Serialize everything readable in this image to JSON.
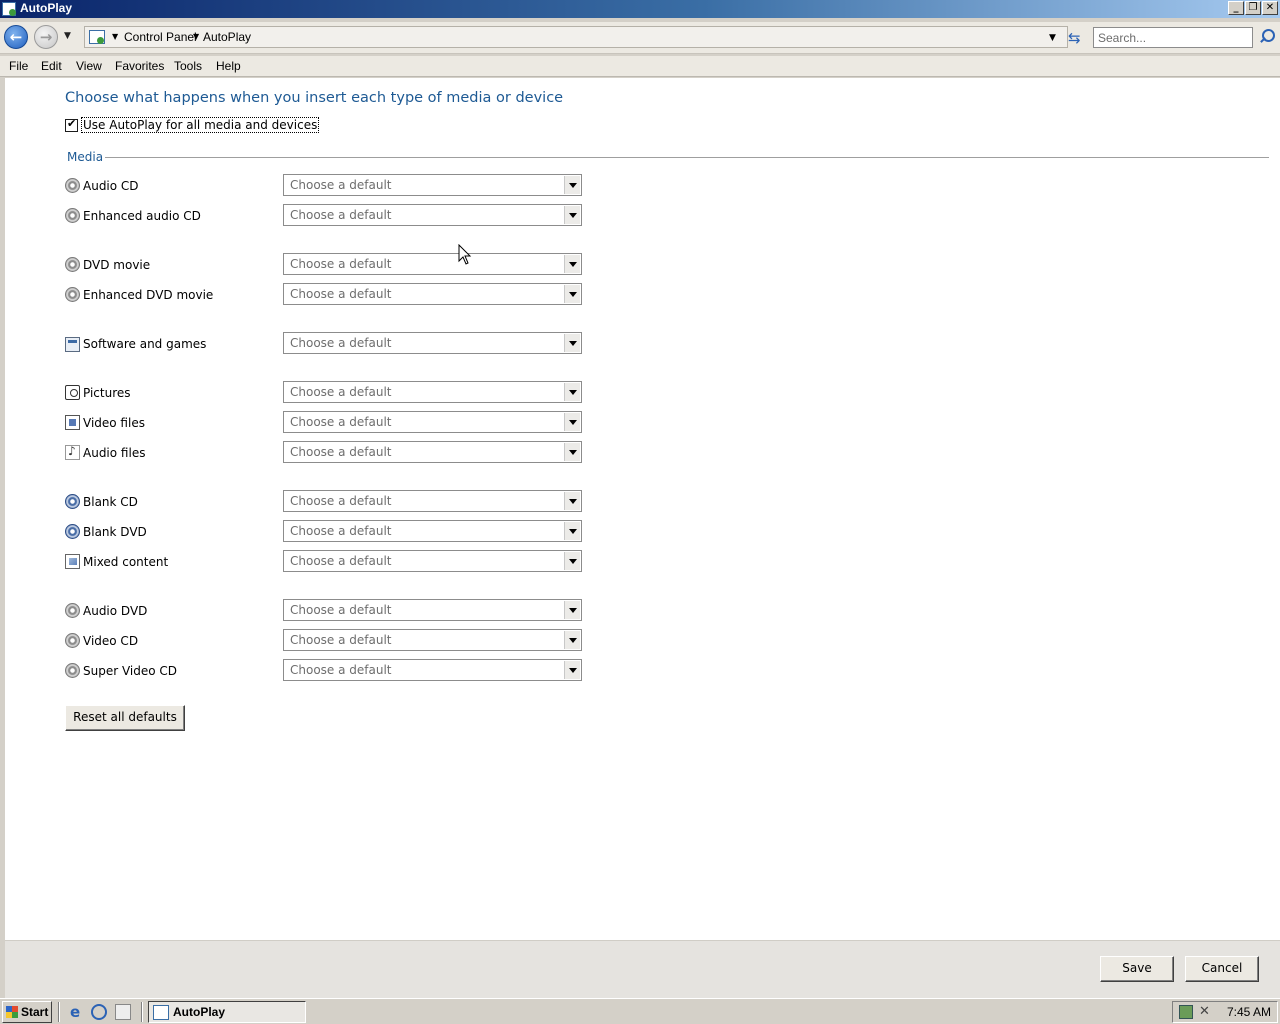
{
  "window": {
    "title": "AutoPlay"
  },
  "address": {
    "crumbs": [
      "Control Panel",
      "AutoPlay"
    ],
    "search_placeholder": "Search..."
  },
  "menu": [
    "File",
    "Edit",
    "View",
    "Favorites",
    "Tools",
    "Help"
  ],
  "content": {
    "heading": "Choose what happens when you insert each type of media or device",
    "use_autoplay_label": "Use AutoPlay for all media and devices",
    "use_autoplay_checked": true,
    "section_label": "Media",
    "select_placeholder": "Choose a default",
    "rows": [
      {
        "label": "Audio CD",
        "icon": "disc-icon",
        "value": "Choose a default"
      },
      {
        "label": "Enhanced audio CD",
        "icon": "disc-icon",
        "value": "Choose a default"
      },
      {
        "label": "DVD movie",
        "icon": "disc-icon",
        "value": "Choose a default"
      },
      {
        "label": "Enhanced DVD movie",
        "icon": "disc-icon",
        "value": "Choose a default"
      },
      {
        "label": "Software and games",
        "icon": "window-icon",
        "value": "Choose a default"
      },
      {
        "label": "Pictures",
        "icon": "camera-icon",
        "value": "Choose a default"
      },
      {
        "label": "Video files",
        "icon": "video-file-icon",
        "value": "Choose a default"
      },
      {
        "label": "Audio files",
        "icon": "music-file-icon",
        "value": "Choose a default"
      },
      {
        "label": "Blank CD",
        "icon": "blank-disc-icon",
        "value": "Choose a default"
      },
      {
        "label": "Blank DVD",
        "icon": "blank-disc-icon",
        "value": "Choose a default"
      },
      {
        "label": "Mixed content",
        "icon": "mixed-content-icon",
        "value": "Choose a default"
      },
      {
        "label": "Audio DVD",
        "icon": "disc-icon",
        "value": "Choose a default"
      },
      {
        "label": "Video CD",
        "icon": "disc-icon",
        "value": "Choose a default"
      },
      {
        "label": "Super Video CD",
        "icon": "disc-icon",
        "value": "Choose a default"
      }
    ],
    "reset_button": "Reset all defaults"
  },
  "footer": {
    "save": "Save",
    "cancel": "Cancel"
  },
  "taskbar": {
    "start": "Start",
    "task": "AutoPlay",
    "clock": "7:45 AM"
  }
}
